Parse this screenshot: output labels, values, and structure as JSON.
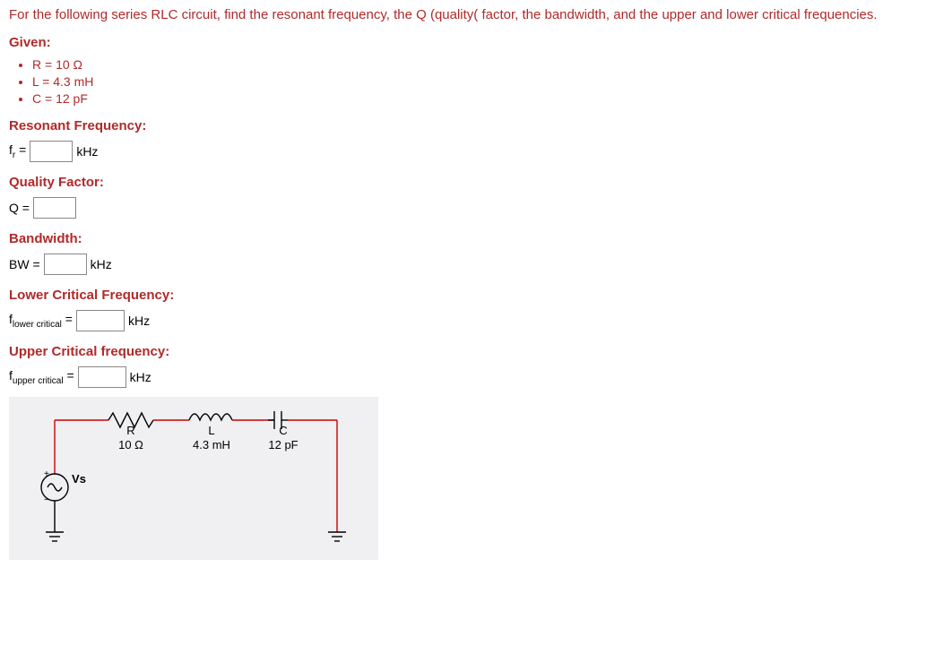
{
  "instruction": "For the following series RLC circuit, find the resonant frequency, the Q (quality( factor, the bandwidth, and the upper and lower critical frequencies.",
  "given": {
    "heading": "Given:",
    "items": [
      "R = 10 Ω",
      "L = 4.3 mH",
      "C = 12 pF"
    ]
  },
  "sections": {
    "resonant": {
      "heading": "Resonant Frequency:",
      "label_pre": "f",
      "label_sub": "r",
      "label_post": " = ",
      "unit": "kHz"
    },
    "quality": {
      "heading": "Quality Factor:",
      "label": "Q = "
    },
    "bandwidth": {
      "heading": "Bandwidth:",
      "label": "BW = ",
      "unit": "kHz"
    },
    "lower": {
      "heading": "Lower Critical Frequency:",
      "label_pre": "f",
      "label_sub": "lower critical",
      "label_post": " = ",
      "unit": "kHz"
    },
    "upper": {
      "heading": "Upper Critical frequency:",
      "label_pre": "f",
      "label_sub": "upper critical",
      "label_post": " = ",
      "unit": "kHz"
    }
  },
  "diagram": {
    "R_label": "R",
    "R_value": "10 Ω",
    "L_label": "L",
    "L_value": "4.3 mH",
    "C_label": "C",
    "C_value": "12 pF",
    "Vs_label": "Vs"
  }
}
